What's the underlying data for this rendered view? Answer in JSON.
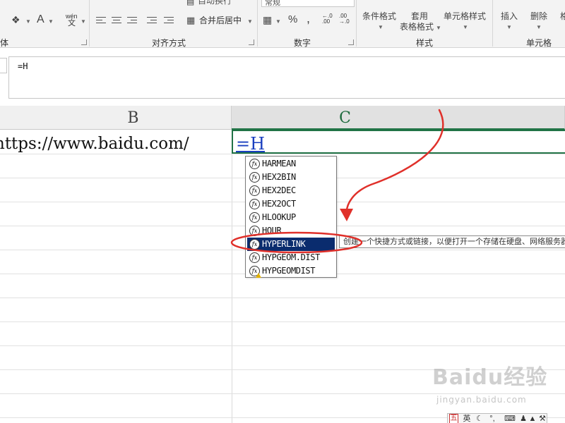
{
  "ribbon": {
    "font_group_label": "体",
    "font_controls": {
      "color_a": "A",
      "wen": "wén",
      "wen_sub": "文"
    },
    "alignment_group_label": "对齐方式",
    "wrap_text_label": "自动换行",
    "merge_center_label": "合并后居中",
    "number_group_label": "数字",
    "number_format_value": "常规",
    "percent_symbol": "%",
    "comma_symbol": ",",
    "styles_group_label": "样式",
    "conditional_format_label": "条件格式",
    "table_format_label_1": "套用",
    "table_format_label_2": "表格格式",
    "cell_styles_label": "单元格样式",
    "cells_group_label": "单元格",
    "insert_label": "插入",
    "delete_label": "删除",
    "format_label": "格式"
  },
  "formula_bar": {
    "value": "=H"
  },
  "columns": {
    "b": "B",
    "c": "C"
  },
  "cells": {
    "b1": "https://www.baidu.com/",
    "c1": "=H"
  },
  "autocomplete": {
    "items": [
      {
        "label": "HARMEAN",
        "icon": "fx-icon"
      },
      {
        "label": "HEX2BIN",
        "icon": "fx-icon"
      },
      {
        "label": "HEX2DEC",
        "icon": "fx-icon"
      },
      {
        "label": "HEX2OCT",
        "icon": "fx-icon"
      },
      {
        "label": "HLOOKUP",
        "icon": "fx-icon"
      },
      {
        "label": "HOUR",
        "icon": "fx-icon"
      },
      {
        "label": "HYPERLINK",
        "icon": "fx-icon",
        "selected": true
      },
      {
        "label": "HYPGEOM.DIST",
        "icon": "fx-icon"
      },
      {
        "label": "HYPGEOMDIST",
        "icon": "fx-warning-icon"
      }
    ],
    "tooltip": "创建一个快捷方式或链接，以便打开一个存储在硬盘、网络服务器或Internet上的文档"
  },
  "annotation": {
    "color": "#e0302a"
  },
  "watermark": {
    "logo": "Baidu经验",
    "url": "jingyan.baidu.com"
  },
  "ime": {
    "mode": "英",
    "logo": "五"
  },
  "colors": {
    "selection_green": "#217346",
    "selected_item": "#0a2c6e",
    "formula_text": "#1a3fbf"
  }
}
